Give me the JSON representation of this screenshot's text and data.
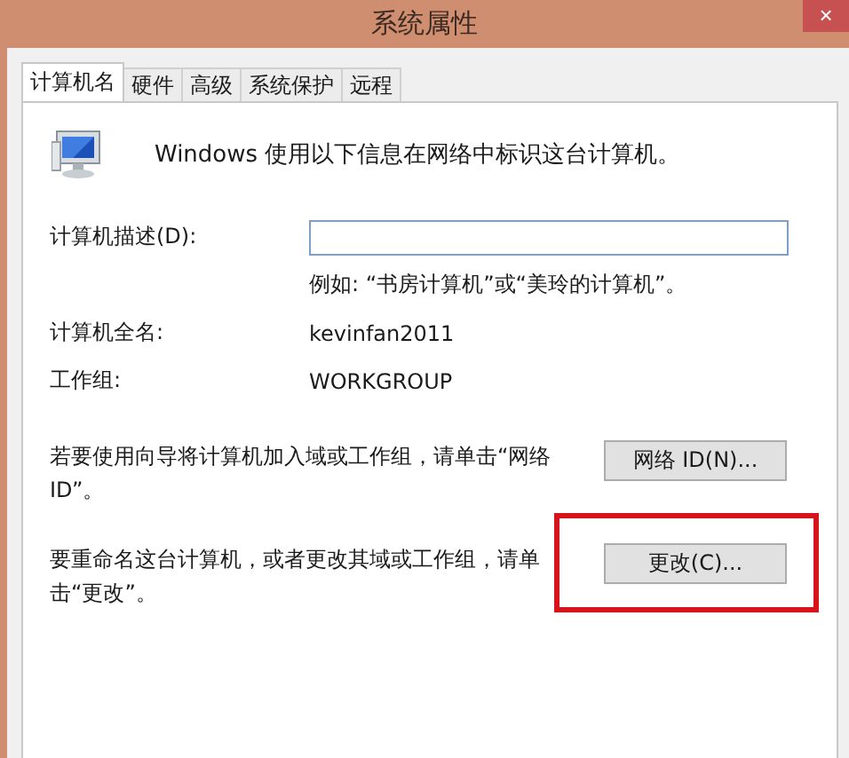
{
  "window": {
    "title": "系统属性",
    "close": "×"
  },
  "tabs": [
    {
      "label": "计算机名",
      "selected": true
    },
    {
      "label": "硬件",
      "selected": false
    },
    {
      "label": "高级",
      "selected": false
    },
    {
      "label": "系统保护",
      "selected": false
    },
    {
      "label": "远程",
      "selected": false
    }
  ],
  "intro": "Windows 使用以下信息在网络中标识这台计算机。",
  "description": {
    "label": "计算机描述(D):",
    "hint": "例如: “书房计算机”或“美玲的计算机”。"
  },
  "info": [
    {
      "label": "计算机全名:",
      "value": "kevinfan2011"
    },
    {
      "label": "工作组:",
      "value": "WORKGROUP"
    }
  ],
  "actions": [
    {
      "text": "若要使用向导将计算机加入域或工作组，请单击“网络 ID”。",
      "button": "网络 ID(N)...",
      "highlighted": false
    },
    {
      "text": "要重命名这台计算机，或者更改其域或工作组，请单击“更改”。",
      "button": "更改(C)...",
      "highlighted": true
    }
  ]
}
